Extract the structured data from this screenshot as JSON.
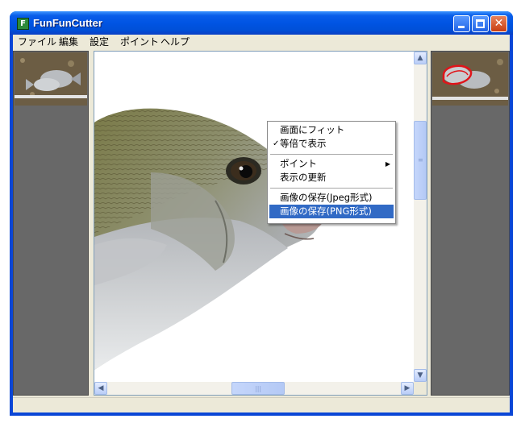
{
  "window": {
    "title": "FunFunCutter",
    "app_icon": "F"
  },
  "titlebar_buttons": {
    "minimize": "minimize-icon",
    "maximize": "maximize-icon",
    "close": "close-icon",
    "close_glyph": "✕"
  },
  "menubar": {
    "items": [
      {
        "label": "ファイル"
      },
      {
        "label": "編集"
      },
      {
        "label": "設定"
      },
      {
        "label": "ポイント"
      },
      {
        "label": "ヘルプ"
      }
    ]
  },
  "context_menu": {
    "items": [
      {
        "label": "画面にフィット",
        "checked": false,
        "submenu": false,
        "selected": false
      },
      {
        "label": "等倍で表示",
        "checked": true,
        "submenu": false,
        "selected": false
      },
      {
        "label": "ポイント",
        "checked": false,
        "submenu": true,
        "selected": false
      },
      {
        "label": "表示の更新",
        "checked": false,
        "submenu": false,
        "selected": false
      },
      {
        "label": "画像の保存(Jpeg形式)",
        "checked": false,
        "submenu": false,
        "selected": false
      },
      {
        "label": "画像の保存(PNG形式)",
        "checked": false,
        "submenu": false,
        "selected": true
      }
    ],
    "check_glyph": "✓",
    "submenu_glyph": "▶"
  },
  "scrollbars": {
    "up_glyph": "▲",
    "down_glyph": "▼",
    "left_glyph": "◀",
    "right_glyph": "▶"
  },
  "colors": {
    "titlebar": "#0054e3",
    "menu_highlight": "#316ac5",
    "panel_background": "#686868",
    "outline_marker": "#e0141a"
  }
}
